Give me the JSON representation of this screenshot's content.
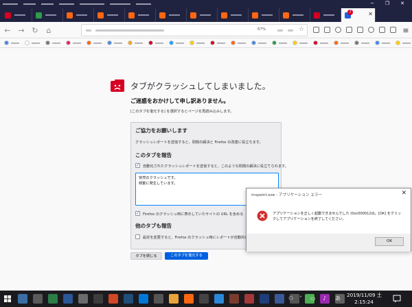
{
  "browser": {
    "menu_count": 7,
    "active_tab": {
      "badge": "7"
    },
    "tabs": [
      {
        "color": "#d70022"
      },
      {
        "color": "#2f9c4a"
      },
      {
        "color": "#ff6611"
      },
      {
        "color": "#ff6611"
      },
      {
        "color": "#ff6611"
      },
      {
        "color": "#ff6611"
      },
      {
        "color": "#ff6611"
      },
      {
        "color": "#ff6611"
      },
      {
        "color": "#ff6611"
      },
      {
        "color": "#ff6611"
      },
      {
        "color": "#d70022"
      }
    ],
    "zoom": "67%"
  },
  "bookmarks": [
    {
      "color": "#4285f4"
    },
    {
      "color": "#ffffff"
    },
    {
      "color": "#777777"
    },
    {
      "color": "#e0245e"
    },
    {
      "color": "#ff6600"
    },
    {
      "color": "#4b8bd4"
    },
    {
      "color": "#f5a623"
    },
    {
      "color": "#d70022"
    },
    {
      "color": "#1da1f2"
    },
    {
      "color": "#ffcc00"
    },
    {
      "color": "#d70022"
    },
    {
      "color": "#ff6611"
    },
    {
      "color": "#4b8bd4"
    },
    {
      "color": "#2f9c4a"
    },
    {
      "color": "#ffcc00"
    },
    {
      "color": "#d70022"
    },
    {
      "color": "#ff6611"
    },
    {
      "color": "#777777"
    },
    {
      "color": "#4285f4"
    },
    {
      "color": "#ffcc00"
    },
    {
      "color": "#2f9c4a"
    },
    {
      "color": "#e0245e"
    },
    {
      "color": "#ff6611"
    }
  ],
  "crash_page": {
    "title": "タブがクラッシュしてしまいました。",
    "apology": "ご迷惑をおかけして申し訳ありません。",
    "instruction": "[このタブを復元する] を選択するとページを再読み込みします。",
    "help_heading": "ご協力をお願いします",
    "help_text": "クラッシュレポートを送信すると、問題の解決と Firefox の改善に役立ちます。",
    "report_heading": "このタブを報告",
    "auto_submit_label": "自動化されたクラッシュレポートを送信すると、このような問題の解決に役立てられます。",
    "comment": "突然のクラッシュです。\n頻繁に発生しています。",
    "include_url_label": "Firefox のクラッシュ時に表示していたサイトの URL を含める",
    "other_tabs_heading": "他のタブも報告",
    "other_tabs_label": "設定を変更すると、Firefox のクラッシュ時にレポートが自動的に送",
    "close_tab_button": "タブを閉じる",
    "restore_tab_button": "このタブを復元する"
  },
  "error_dialog": {
    "title": "mspaint.exe - アプリケーション エラー",
    "message_line1": "アプリケーションを正しく起動できませんでした (0xc000012d)。[OK] をクリッ",
    "message_line2": "クしてアプリケーションを終了してください。",
    "ok_button": "OK"
  },
  "taskbar": {
    "apps": [
      {
        "color": "#3a6ea5"
      },
      {
        "color": "#5a5a5a"
      },
      {
        "color": "#2d7d46"
      },
      {
        "color": "#2b5797"
      },
      {
        "color": "#6b6b6b"
      },
      {
        "color": "#3c3c3c"
      },
      {
        "color": "#d24726"
      },
      {
        "color": "#1e4e79"
      },
      {
        "color": "#0078d7"
      },
      {
        "color": "#555555"
      },
      {
        "color": "#e8a33c"
      },
      {
        "color": "#ff6611"
      },
      {
        "color": "#444444"
      },
      {
        "color": "#2b88d8"
      },
      {
        "color": "#7a3b2e"
      },
      {
        "color": "#a4373a"
      },
      {
        "color": "#1f3d7a"
      },
      {
        "color": "#3b5998"
      },
      {
        "color": "#555555"
      },
      {
        "color": "#4caf50"
      },
      {
        "color": "#9c27b0"
      },
      {
        "color": "#606060"
      }
    ],
    "ime_label": "あ",
    "date": "2019/11/09 土",
    "time": "2:15:24"
  }
}
